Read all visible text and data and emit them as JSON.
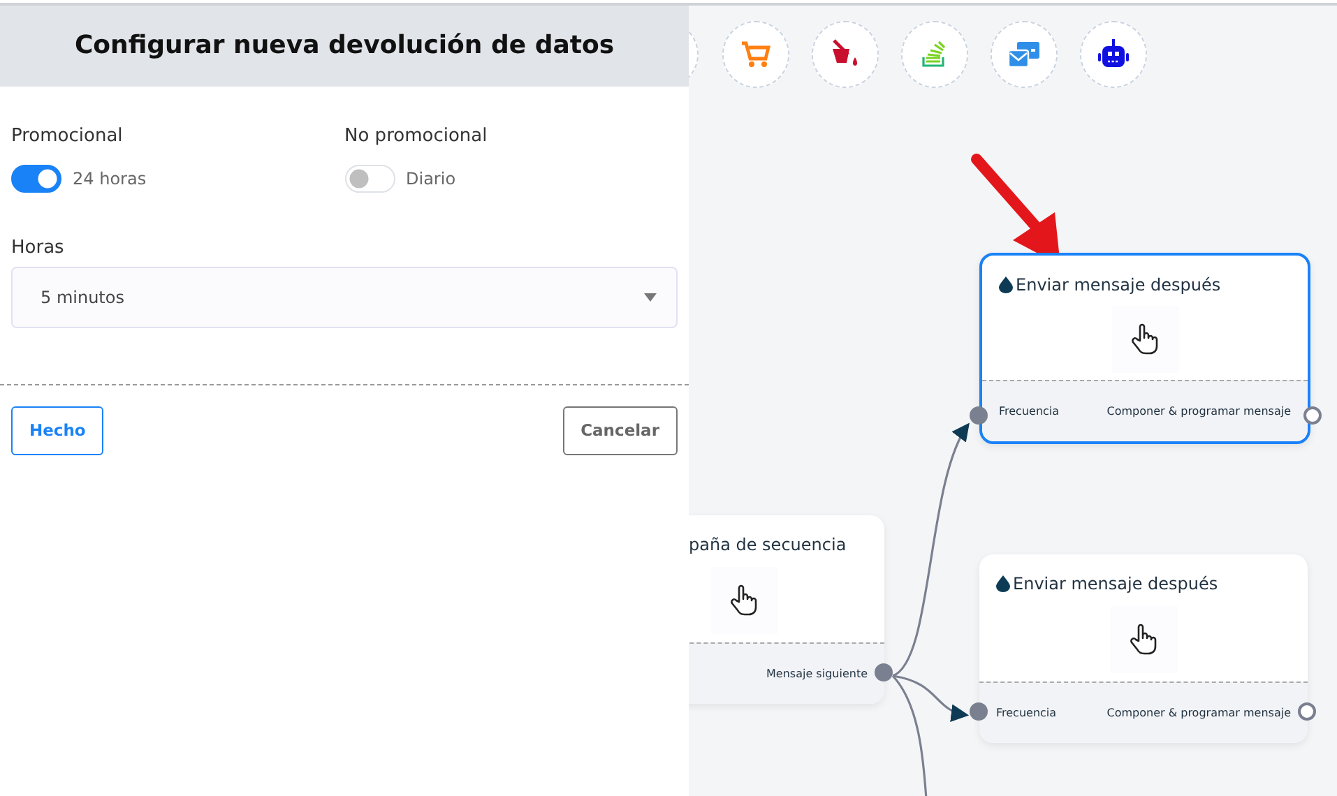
{
  "panel": {
    "title": "Configurar nueva devolución de datos",
    "toggles": [
      {
        "heading": "Promocional",
        "label": "24 horas",
        "on": true
      },
      {
        "heading": "No promocional",
        "label": "Diario",
        "on": false
      }
    ],
    "select": {
      "label": "Horas",
      "value": "5 minutos"
    },
    "buttons": [
      {
        "label": "Hecho",
        "kind": "primary"
      },
      {
        "label": "Cancelar",
        "kind": "secondary"
      }
    ]
  },
  "canvas": {
    "nodes": [
      {
        "title": "paña de secuencia",
        "icon": false,
        "selected": false,
        "output": {
          "label": "Mensaje siguiente",
          "connected": true
        }
      },
      {
        "title": "Enviar mensaje después",
        "icon": true,
        "selected": true,
        "input": {
          "label": "Frecuencia"
        },
        "output": {
          "label": "Componer & programar mensaje",
          "connected": false
        }
      },
      {
        "title": "Enviar mensaje después",
        "icon": true,
        "selected": false,
        "input": {
          "label": "Frecuencia"
        },
        "output": {
          "label": "Componer & programar mensaje",
          "connected": false
        }
      }
    ]
  }
}
